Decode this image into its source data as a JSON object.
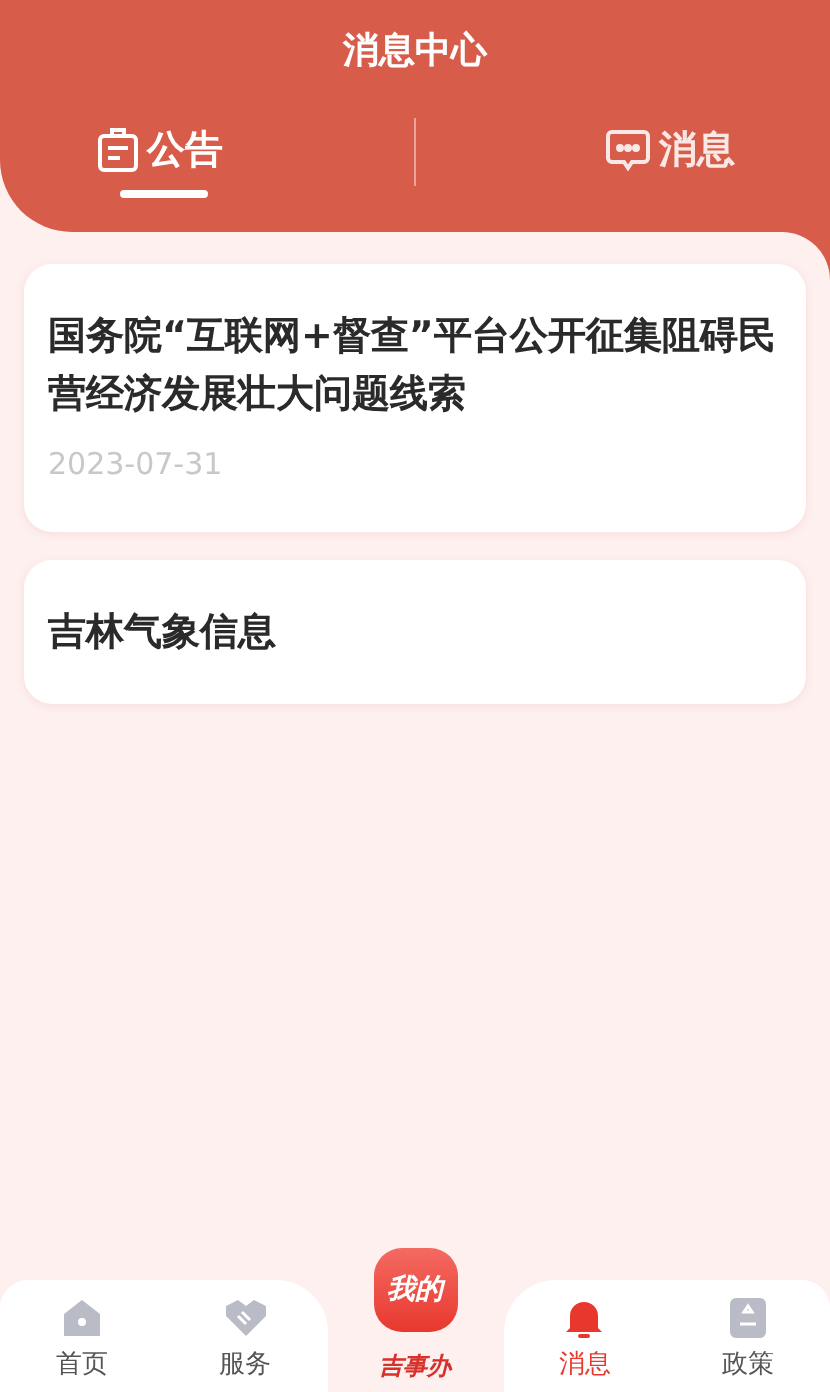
{
  "header": {
    "title": "消息中心"
  },
  "tabs": [
    {
      "label": "公告",
      "selected": true
    },
    {
      "label": "消息",
      "selected": false
    }
  ],
  "notices": [
    {
      "title": "国务院“互联网+督查”平台公开征集阻碍民营经济发展壮大问题线索",
      "date": "2023-07-31"
    },
    {
      "title": "吉林气象信息"
    }
  ],
  "bottom_nav": [
    {
      "label": "首页",
      "kind": "tab",
      "selected": false
    },
    {
      "label": "服务",
      "kind": "tab",
      "selected": false
    },
    {
      "label": "吉事办",
      "badge": "我的",
      "kind": "center",
      "selected": false
    },
    {
      "label": "消息",
      "kind": "tab",
      "selected": true
    },
    {
      "label": "政策",
      "kind": "tab",
      "selected": false
    }
  ]
}
